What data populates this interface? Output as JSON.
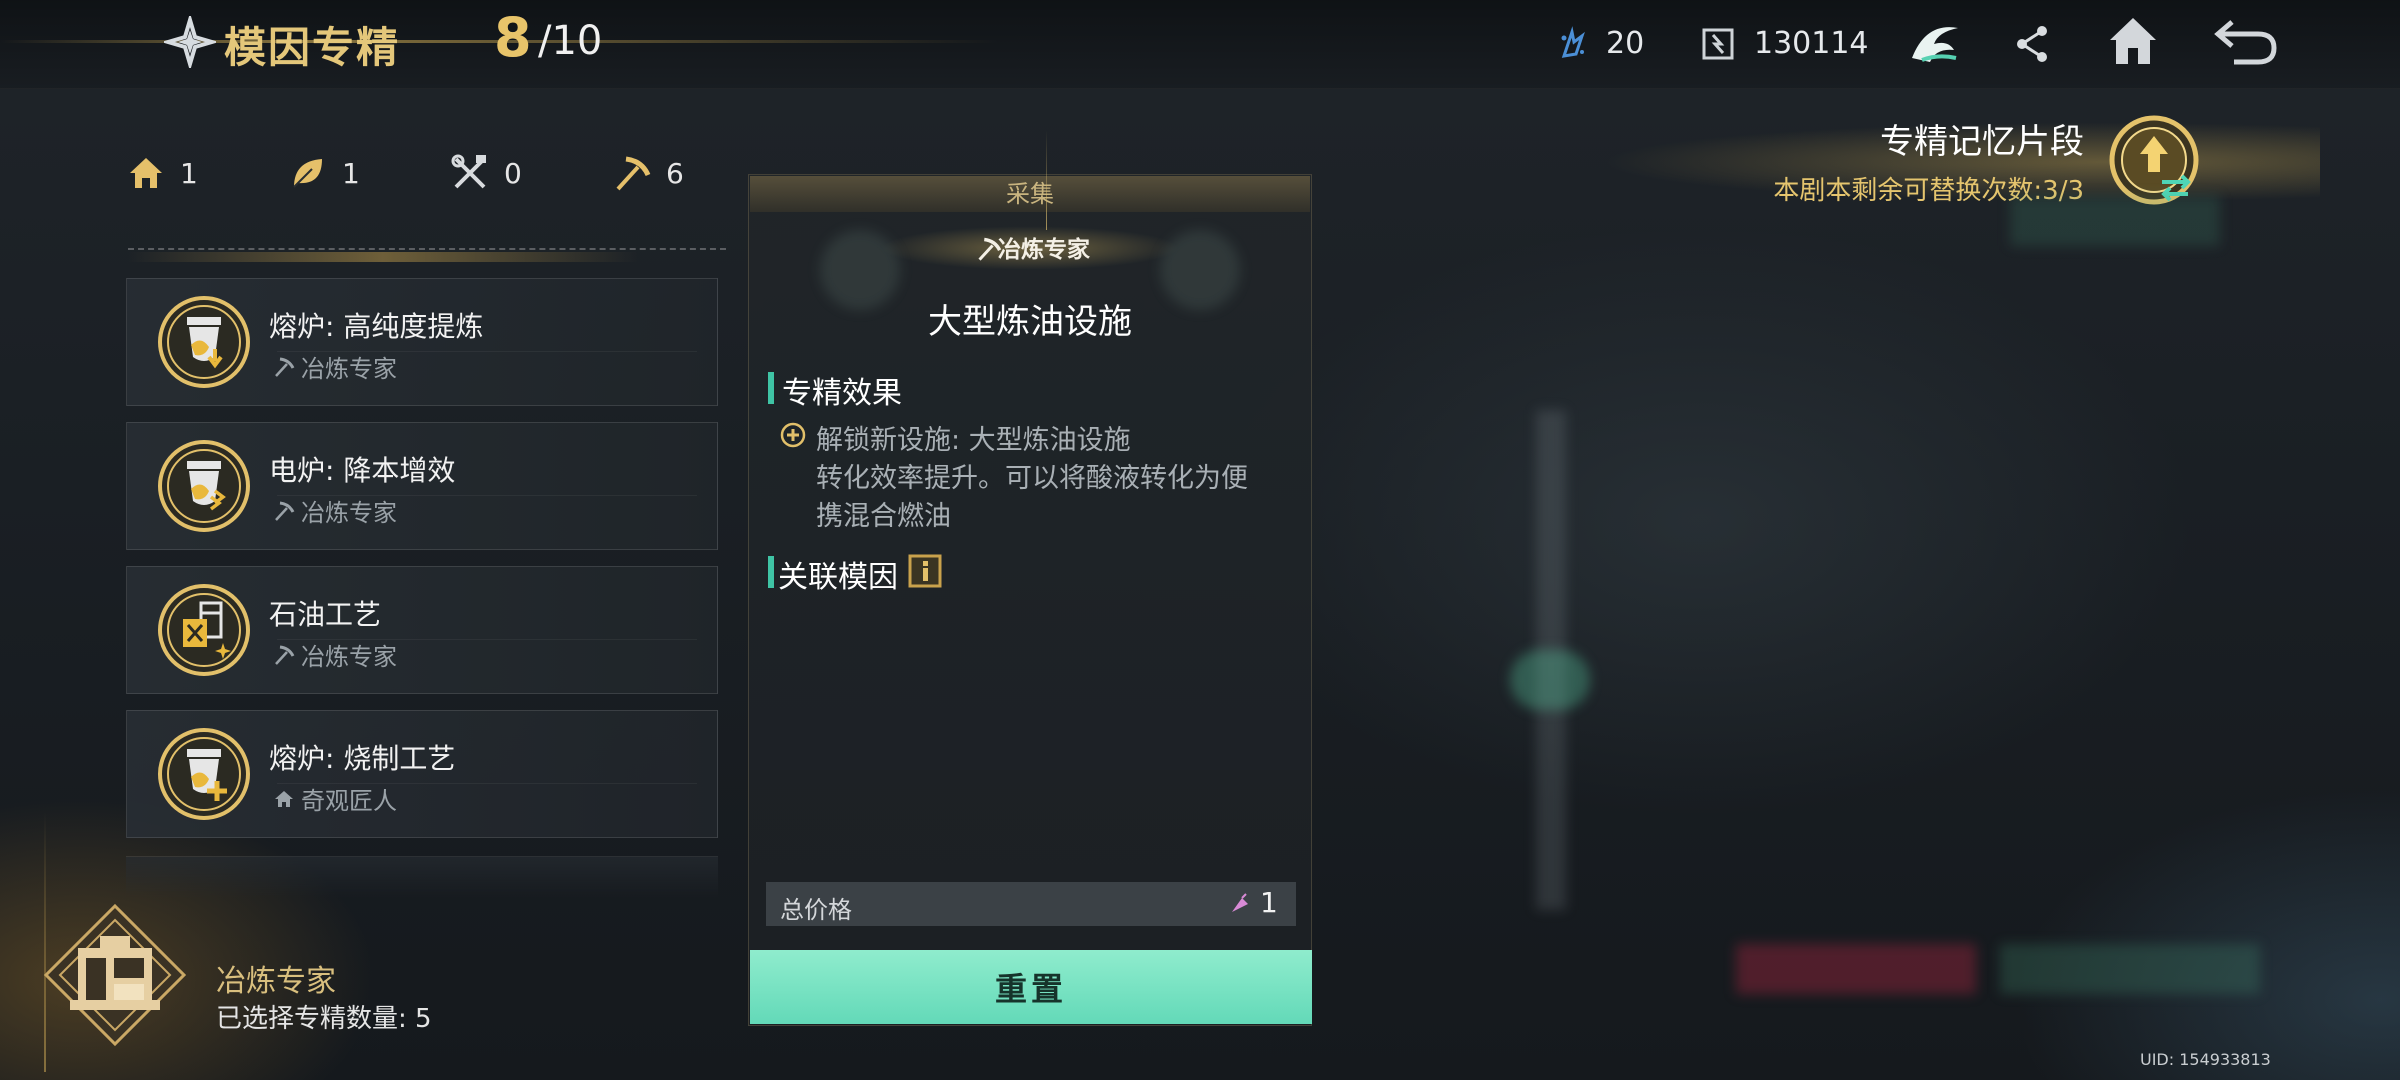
{
  "header": {
    "title": "模因专精",
    "count_current": "8",
    "count_max": "/10",
    "resources": [
      {
        "icon": "crystal-icon",
        "value": "20"
      },
      {
        "icon": "token-icon",
        "value": "130114"
      }
    ],
    "buttons": [
      "faction-emblem-icon",
      "share-icon",
      "home-icon",
      "back-icon"
    ]
  },
  "stats": [
    {
      "icon": "house-icon",
      "value": "1"
    },
    {
      "icon": "leaf-icon",
      "value": "1"
    },
    {
      "icon": "tools-icon",
      "value": "0"
    },
    {
      "icon": "pickaxe-icon",
      "value": "6"
    }
  ],
  "items": [
    {
      "name": "熔炉: 高纯度提炼",
      "tag": "冶炼专家",
      "tag_icon": "pickaxe-icon"
    },
    {
      "name": "电炉: 降本增效",
      "tag": "冶炼专家",
      "tag_icon": "pickaxe-icon"
    },
    {
      "name": "石油工艺",
      "tag": "冶炼专家",
      "tag_icon": "pickaxe-icon"
    },
    {
      "name": "熔炉: 烧制工艺",
      "tag": "奇观匠人",
      "tag_icon": "house-icon"
    }
  ],
  "profile": {
    "name": "冶炼专家",
    "selected_count": "已选择专精数量: 5"
  },
  "detail": {
    "category": "采集",
    "tag": "冶炼专家",
    "title": "大型炼油设施",
    "effect_title": "专精效果",
    "effect_lines": [
      "解锁新设施: 大型炼油设施",
      "转化效率提升。可以将酸液转化为便",
      "携混合燃油"
    ],
    "related_title": "关联模因",
    "price_label": "总价格",
    "price_value": "1",
    "reset_label": "重置"
  },
  "memory": {
    "title": "专精记忆片段",
    "subtitle": "本剧本剩余可替换次数:3/3"
  },
  "uid": "UID: 154933813",
  "colors": {
    "gold": "#e4c77a",
    "accent_teal": "#63d9b8",
    "section_bar": "#3fc4a5"
  }
}
